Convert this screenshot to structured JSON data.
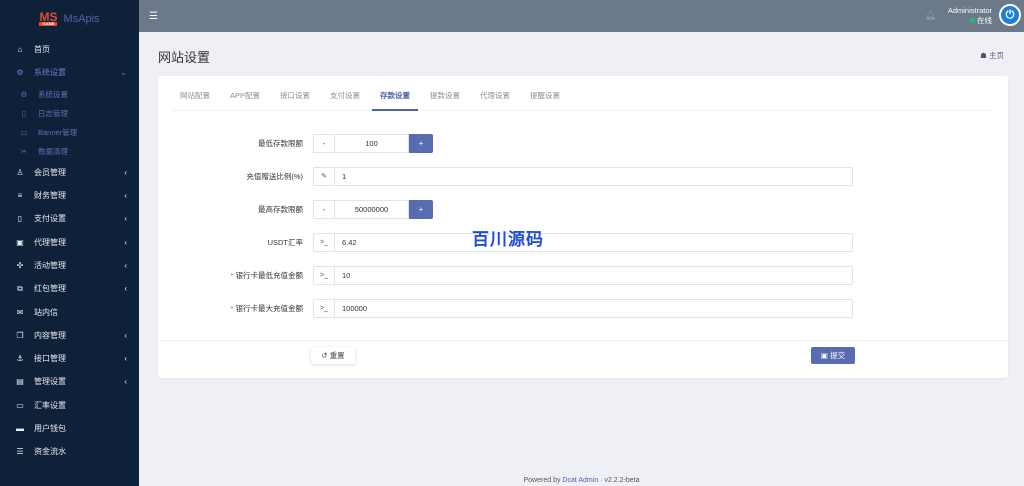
{
  "brand": {
    "logo_text": "MS",
    "logo_sub": "GAME",
    "name": "MsApis"
  },
  "sidebar": {
    "items": [
      {
        "label": "首页",
        "icon": "home-icon",
        "glyph": "⌂"
      },
      {
        "label": "系统设置",
        "icon": "cogs-icon",
        "glyph": "⚙",
        "expanded": true,
        "chevron": "⌄",
        "children": [
          {
            "label": "系统设置",
            "icon": "gear-icon",
            "glyph": "⚙"
          },
          {
            "label": "日志管理",
            "icon": "file-icon",
            "glyph": "▯"
          },
          {
            "label": "Banner管理",
            "icon": "image-icon",
            "glyph": "▭"
          },
          {
            "label": "数据清理",
            "icon": "scissors-icon",
            "glyph": "✂"
          }
        ]
      },
      {
        "label": "会员管理",
        "icon": "user-icon",
        "glyph": "♙",
        "chevron": "‹"
      },
      {
        "label": "财务管理",
        "icon": "database-icon",
        "glyph": "≡",
        "chevron": "‹"
      },
      {
        "label": "支付设置",
        "icon": "bookmark-icon",
        "glyph": "▯",
        "chevron": "‹"
      },
      {
        "label": "代理管理",
        "icon": "portrait-icon",
        "glyph": "▣",
        "chevron": "‹"
      },
      {
        "label": "活动管理",
        "icon": "puzzle-icon",
        "glyph": "✣",
        "chevron": "‹"
      },
      {
        "label": "红包管理",
        "icon": "clone-icon",
        "glyph": "⧉",
        "chevron": "‹"
      },
      {
        "label": "站内信",
        "icon": "envelope-icon",
        "glyph": "✉"
      },
      {
        "label": "内容管理",
        "icon": "copy-icon",
        "glyph": "❐",
        "chevron": "‹"
      },
      {
        "label": "接口管理",
        "icon": "anchor-icon",
        "glyph": "⚓",
        "chevron": "‹"
      },
      {
        "label": "管理设置",
        "icon": "id-card-icon",
        "glyph": "▤",
        "chevron": "‹"
      },
      {
        "label": "汇率设置",
        "icon": "money-icon",
        "glyph": "▭"
      },
      {
        "label": "用户钱包",
        "icon": "credit-card-icon",
        "glyph": "▬"
      },
      {
        "label": "资金流水",
        "icon": "list-icon",
        "glyph": "☰"
      }
    ]
  },
  "header": {
    "user_name": "Administrator",
    "status": "在线"
  },
  "page": {
    "title": "网站设置",
    "home_link": "主页"
  },
  "tabs": [
    "网站配置",
    "APP配置",
    "接口设置",
    "支付设置",
    "存款设置",
    "提款设置",
    "代理设置",
    "提醒设置"
  ],
  "active_tab": 4,
  "form": {
    "min_deposit": {
      "label": "最低存款限额",
      "value": "100",
      "minus": "-",
      "plus": "+"
    },
    "bonus_ratio": {
      "label": "充值赠送比例(%)",
      "value": "1"
    },
    "max_deposit": {
      "label": "最高存款限额",
      "value": "50000000",
      "minus": "-",
      "plus": "+"
    },
    "usdt_rate": {
      "label": "USDT汇率",
      "value": "6.42"
    },
    "bank_min": {
      "label": "银行卡最低充值金额",
      "value": "10",
      "required": "*"
    },
    "bank_max": {
      "label": "银行卡最大充值金额",
      "value": "100000",
      "required": "*"
    },
    "reset_label": "重置",
    "submit_label": "提交"
  },
  "watermark": "百川源码",
  "footer": {
    "prefix": "Powered by",
    "link": "Dcat Admin",
    "sep": "·",
    "version": "v2.2.2-beta"
  },
  "colors": {
    "sidebar": "#0f2139",
    "header": "#6c798a",
    "accent": "#586cb1"
  }
}
